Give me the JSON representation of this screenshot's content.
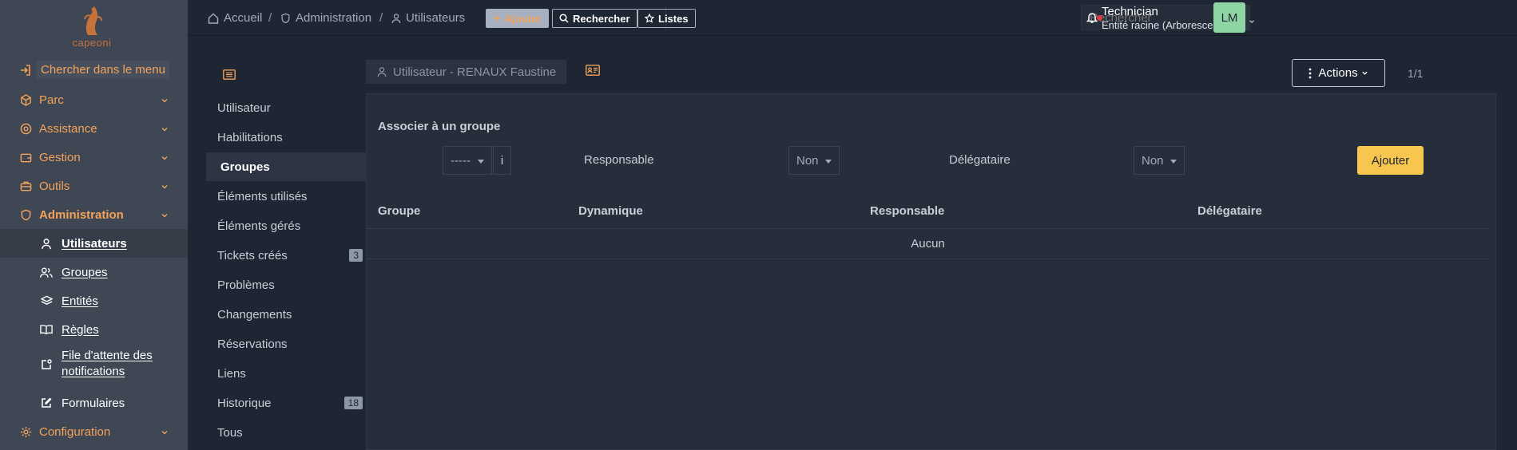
{
  "sidebar": {
    "logo_text": "capeoni",
    "menu_search_label": "Chercher dans le menu",
    "menu": [
      {
        "label": "Parc",
        "icon": "cube-icon"
      },
      {
        "label": "Assistance",
        "icon": "lifebuoy-icon"
      },
      {
        "label": "Gestion",
        "icon": "wallet-icon"
      },
      {
        "label": "Outils",
        "icon": "briefcase-icon"
      },
      {
        "label": "Administration",
        "icon": "shield-icon"
      },
      {
        "label": "Configuration",
        "icon": "gear-icon"
      }
    ],
    "admin_submenu": [
      {
        "label": "Utilisateurs",
        "icon": "user-icon"
      },
      {
        "label": "Groupes",
        "icon": "users-icon"
      },
      {
        "label": "Entités",
        "icon": "layers-icon"
      },
      {
        "label": "Règles",
        "icon": "book-icon"
      },
      {
        "label": "File d'attente des notifications",
        "icon": "notification-queue-icon"
      },
      {
        "label": "Formulaires",
        "icon": "edit-icon"
      }
    ]
  },
  "header": {
    "breadcrumbs": [
      "Accueil",
      "Administration",
      "Utilisateurs"
    ],
    "buttons": {
      "add": "Ajouter",
      "search": "Rechercher",
      "lists": "Listes"
    },
    "search_placeholder": "Rechercher",
    "user_name": "Technician",
    "user_entity": "Entité racine (Arborescence)",
    "avatar_initials": "LM"
  },
  "tabs": [
    {
      "label": "Utilisateur"
    },
    {
      "label": "Habilitations"
    },
    {
      "label": "Groupes"
    },
    {
      "label": "Éléments utilisés"
    },
    {
      "label": "Éléments gérés"
    },
    {
      "label": "Tickets créés",
      "count": "3"
    },
    {
      "label": "Problèmes"
    },
    {
      "label": "Changements"
    },
    {
      "label": "Réservations"
    },
    {
      "label": "Liens"
    },
    {
      "label": "Historique",
      "count": "18"
    },
    {
      "label": "Tous"
    }
  ],
  "titlebar": {
    "title": "Utilisateur - RENAUX Faustine",
    "actions_label": "Actions",
    "pager": "1/1"
  },
  "form": {
    "title": "Associer à un groupe",
    "group_select_value": "-----",
    "info_label": "i",
    "responsable_label": "Responsable",
    "responsable_value": "Non",
    "delegataire_label": "Délégataire",
    "delegataire_value": "Non",
    "add_button": "Ajouter"
  },
  "table": {
    "columns": [
      "Groupe",
      "Dynamique",
      "Responsable",
      "Délégataire"
    ],
    "empty_text": "Aucun"
  },
  "colors": {
    "accent": "#f3a35a",
    "primary_button": "#f7c64f",
    "sidebar_bg": "#3f4754",
    "page_bg": "#1e2533",
    "avatar_bg": "#8fd5a3",
    "notification_dot": "#e2393a"
  }
}
